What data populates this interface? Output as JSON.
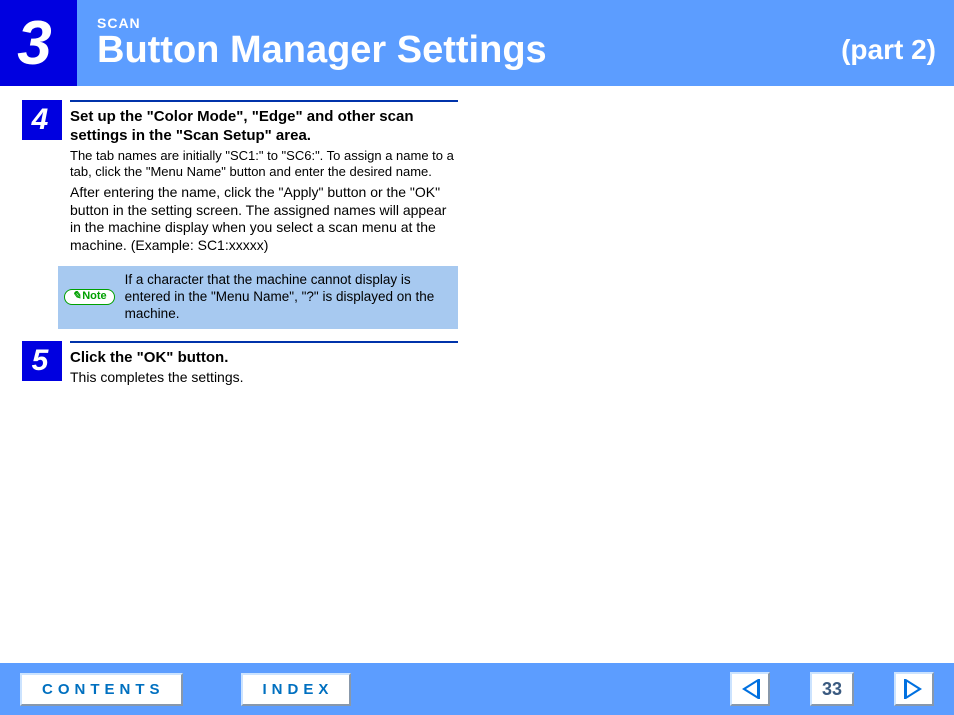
{
  "header": {
    "chapter_number": "3",
    "scan_label": "SCAN",
    "title": "Button Manager Settings",
    "part": "(part 2)"
  },
  "steps": [
    {
      "num": "4",
      "title": "Set up the \"Color Mode\", \"Edge\" and other scan settings in the \"Scan Setup\" area.",
      "sub": "The tab names are initially \"SC1:\" to \"SC6:\". To assign a name to a tab, click the \"Menu Name\" button and enter the desired name.",
      "para": "After entering the name, click the \"Apply\" button or the \"OK\" button in the setting screen. The assigned names will appear in the machine display when you select a scan menu at the machine. (Example: SC1:xxxxx)"
    },
    {
      "num": "5",
      "title": "Click the \"OK\" button.",
      "sub": "This completes the settings.",
      "para": ""
    }
  ],
  "note": {
    "pill": "Note",
    "text": "If a character that the machine cannot display is entered in the \"Menu Name\", \"?\" is displayed on the machine."
  },
  "footer": {
    "contents": "CONTENTS",
    "index": "INDEX",
    "page": "33"
  }
}
